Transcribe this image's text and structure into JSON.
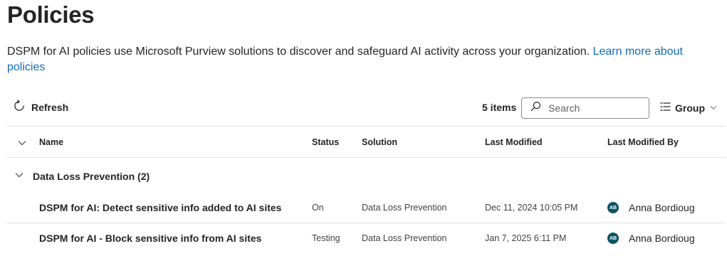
{
  "page": {
    "title": "Policies",
    "description": "DSPM for AI policies use Microsoft Purview solutions to discover and safeguard AI activity across your organization.",
    "learn_more": "Learn more about policies"
  },
  "toolbar": {
    "refresh_label": "Refresh",
    "items_count": "5 items",
    "search_placeholder": "Search",
    "group_label": "Group"
  },
  "table": {
    "headers": {
      "name": "Name",
      "status": "Status",
      "solution": "Solution",
      "last_modified": "Last Modified",
      "last_modified_by": "Last Modified By"
    },
    "group": {
      "label": "Data Loss Prevention (2)"
    },
    "rows": [
      {
        "name": "DSPM for AI: Detect sensitive info added to AI sites",
        "status": "On",
        "solution": "Data Loss Prevention",
        "last_modified": "Dec 11, 2024 10:05 PM",
        "avatar_initials": "AB",
        "last_modified_by": "Anna Bordioug"
      },
      {
        "name": "DSPM for AI - Block sensitive info from AI sites",
        "status": "Testing",
        "solution": "Data Loss Prevention",
        "last_modified": "Jan 7, 2025 6:11 PM",
        "avatar_initials": "AB",
        "last_modified_by": "Anna Bordioug"
      }
    ]
  },
  "colors": {
    "link": "#0f6cbd",
    "avatar": "#0a5466",
    "divider": "#e0e0e0"
  }
}
